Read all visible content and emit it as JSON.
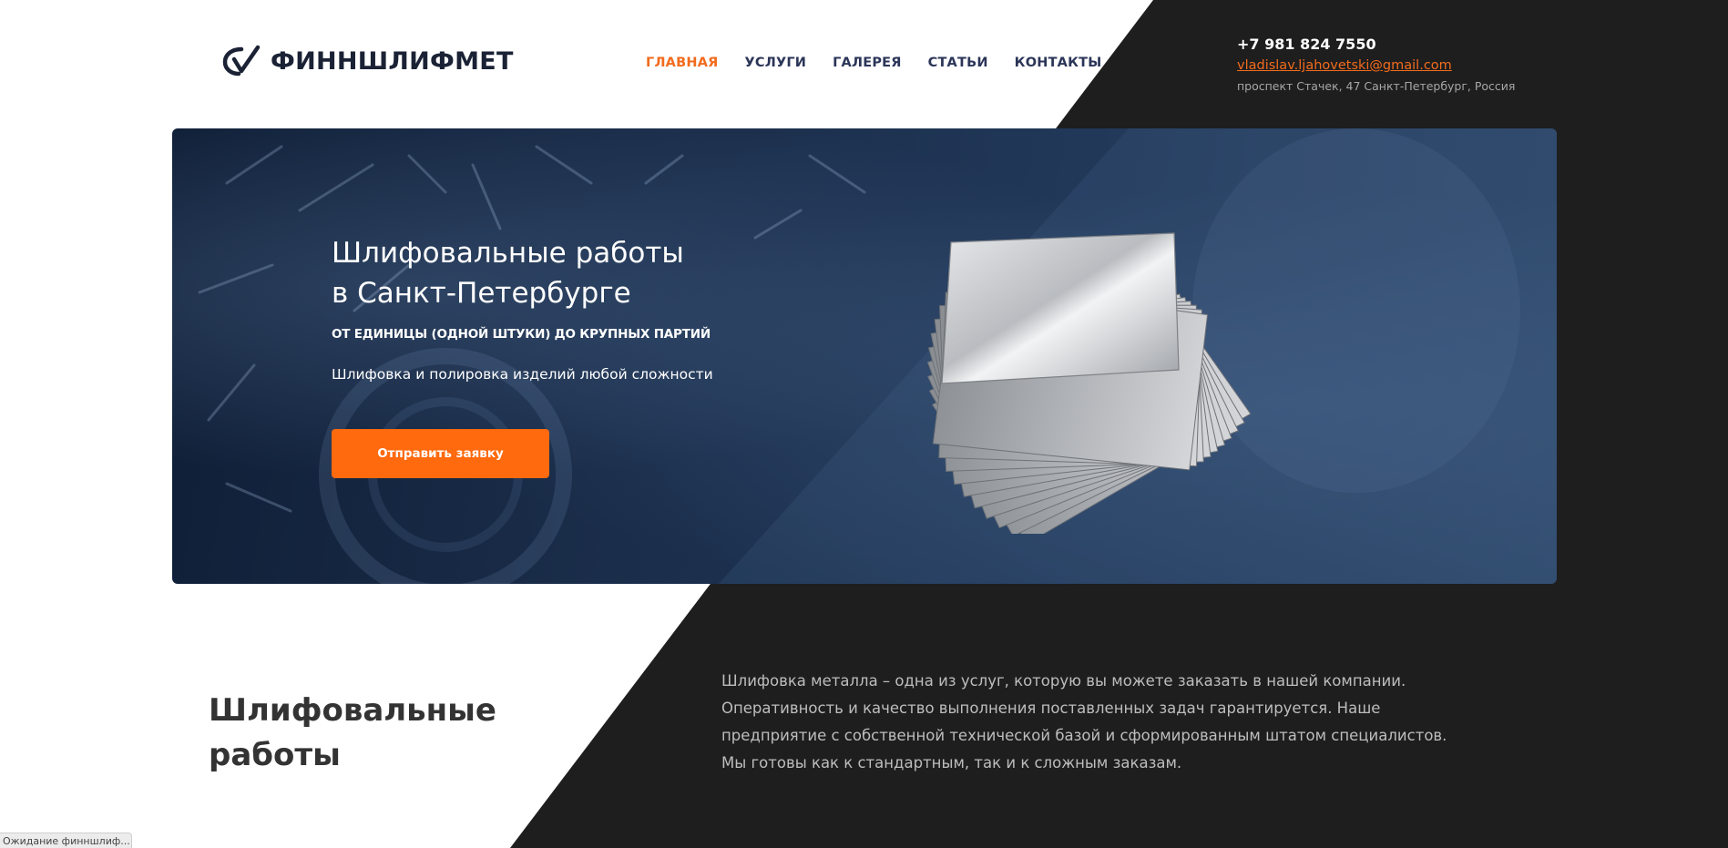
{
  "header": {
    "logo_text": "ФИННШЛИФМЕТ",
    "nav": [
      {
        "label": "ГЛАВНАЯ",
        "active": true
      },
      {
        "label": "УСЛУГИ",
        "active": false
      },
      {
        "label": "ГАЛЕРЕЯ",
        "active": false
      },
      {
        "label": "СТАТЬИ",
        "active": false
      },
      {
        "label": "КОНТАКТЫ",
        "active": false
      }
    ],
    "phone": "+7 981 824 7550",
    "email": "vladislav.ljahovetski@gmail.com",
    "address": "проспект Стачек, 47 Санкт-Петербург, Россия"
  },
  "hero": {
    "title_line1": "Шлифовальные работы",
    "title_line2": "в Санкт-Петербурге",
    "subtitle": "ОТ ЕДИНИЦЫ (ОДНОЙ ШТУКИ) ДО КРУПНЫХ ПАРТИЙ",
    "description": "Шлифовка и полировка изделий любой сложности",
    "button_label": "Отправить заявку"
  },
  "about": {
    "title_line1": "Шлифовальные",
    "title_line2": "работы",
    "text_lines": [
      "Шлифовка металла – одна из услуг, которую вы можете заказать в нашей компании.",
      "Оперативность и качество выполнения поставленных задач гарантируется. Наше",
      "предприятие с собственной технической базой и сформированным штатом специалистов.",
      "Мы готовы как к стандартным, так и к сложным заказам."
    ]
  },
  "status_bar": {
    "text": "Ожидание финншлиф..."
  },
  "colors": {
    "accent": "#ff6a0e",
    "nav_text": "#2b3558",
    "dark_bg": "#1e1e1e",
    "hero_bg": "#1a2d4a"
  }
}
